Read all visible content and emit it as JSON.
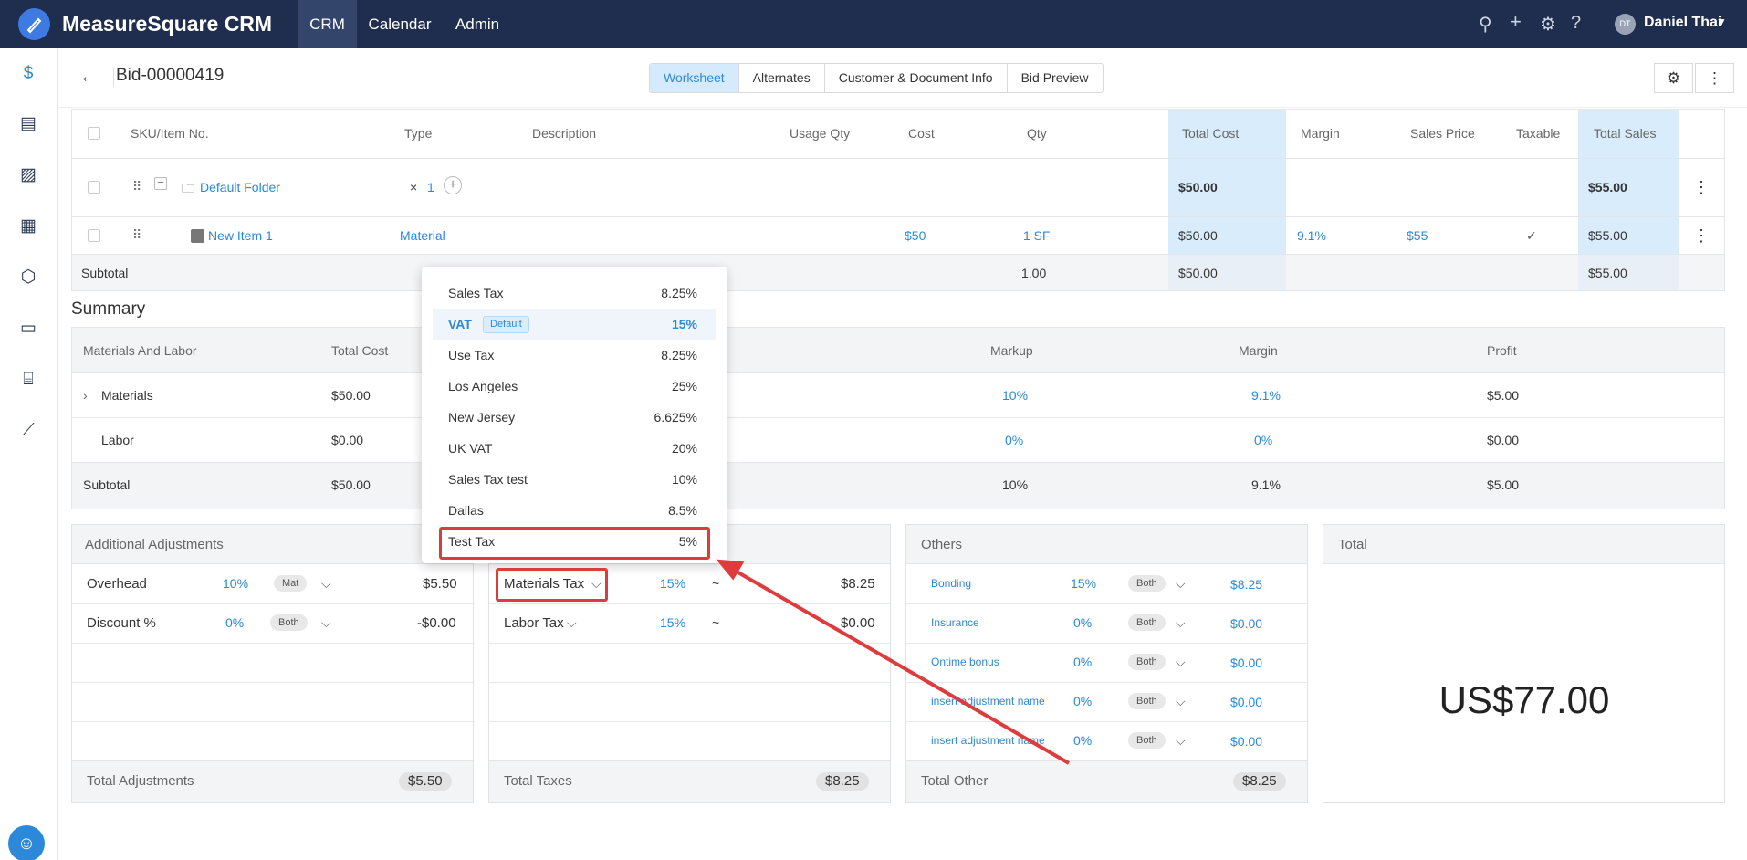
{
  "app": {
    "name": "MeasureSquare CRM",
    "nav": [
      "CRM",
      "Calendar",
      "Admin"
    ],
    "user_initials": "DT",
    "user_name": "Daniel Thai"
  },
  "header": {
    "title": "Bid-00000419",
    "tabs": [
      "Worksheet",
      "Alternates",
      "Customer & Document Info",
      "Bid Preview"
    ]
  },
  "grid": {
    "columns": [
      "SKU/Item No.",
      "Type",
      "Description",
      "Usage Qty",
      "Cost",
      "Qty",
      "Total Cost",
      "Margin",
      "Sales Price",
      "Taxable",
      "Total Sales"
    ],
    "folder": {
      "name": "Default Folder",
      "mult": "×",
      "qty": "1",
      "total_cost": "$50.00",
      "total_sales": "$55.00"
    },
    "item": {
      "name": "New Item 1",
      "type": "Material",
      "cost": "$50",
      "qty": "1 SF",
      "total_cost": "$50.00",
      "margin": "9.1%",
      "sales_price": "$55",
      "taxable": "✓",
      "total_sales": "$55.00"
    },
    "subtotal": {
      "label": "Subtotal",
      "qty": "1.00",
      "total_cost": "$50.00",
      "total_sales": "$55.00"
    }
  },
  "summary": {
    "title": "Summary",
    "columns": [
      "Materials And Labor",
      "Total Cost",
      "Markup",
      "Margin",
      "Profit"
    ],
    "rows": [
      {
        "name": "Materials",
        "cost": "$50.00",
        "markup": "10%",
        "margin": "9.1%",
        "profit": "$5.00"
      },
      {
        "name": "Labor",
        "cost": "$0.00",
        "markup": "0%",
        "margin": "0%",
        "profit": "$0.00"
      },
      {
        "name": "Subtotal",
        "cost": "$50.00",
        "markup": "10%",
        "margin": "9.1%",
        "profit": "$5.00"
      }
    ]
  },
  "adjustments": {
    "title": "Additional Adjustments",
    "rows": [
      {
        "name": "Overhead",
        "pct": "10%",
        "scope": "Mat",
        "amount": "$5.50"
      },
      {
        "name": "Discount %",
        "pct": "0%",
        "scope": "Both",
        "amount": "-$0.00"
      }
    ],
    "total_label": "Total Adjustments",
    "total": "$5.50"
  },
  "taxes": {
    "rows": [
      {
        "name": "Materials Tax",
        "pct": "15%",
        "sym": "~",
        "amount": "$8.25"
      },
      {
        "name": "Labor Tax",
        "pct": "15%",
        "sym": "~",
        "amount": "$0.00"
      }
    ],
    "total_label": "Total Taxes",
    "total": "$8.25"
  },
  "others": {
    "title": "Others",
    "rows": [
      {
        "name": "Bonding",
        "pct": "15%",
        "scope": "Both",
        "amount": "$8.25"
      },
      {
        "name": "Insurance",
        "pct": "0%",
        "scope": "Both",
        "amount": "$0.00"
      },
      {
        "name": "Ontime bonus",
        "pct": "0%",
        "scope": "Both",
        "amount": "$0.00"
      },
      {
        "name": "insert adjustment name",
        "pct": "0%",
        "scope": "Both",
        "amount": "$0.00"
      },
      {
        "name": "insert adjustment name",
        "pct": "0%",
        "scope": "Both",
        "amount": "$0.00"
      }
    ],
    "total_label": "Total Other",
    "total": "$8.25"
  },
  "total": {
    "title": "Total",
    "value": "US$77.00"
  },
  "tax_dropdown": {
    "options": [
      {
        "name": "Sales Tax",
        "value": "8.25%"
      },
      {
        "name": "VAT",
        "value": "15%",
        "badge": "Default"
      },
      {
        "name": "Use Tax",
        "value": "8.25%"
      },
      {
        "name": "Los Angeles",
        "value": "25%"
      },
      {
        "name": "New Jersey",
        "value": "6.625%"
      },
      {
        "name": "UK VAT",
        "value": "20%"
      },
      {
        "name": "Sales Tax test",
        "value": "10%"
      },
      {
        "name": "Dallas",
        "value": "8.5%"
      },
      {
        "name": "Test Tax",
        "value": "5%"
      }
    ]
  },
  "colors": {
    "topbar": "#1f2d4e",
    "accent": "#2c88d9",
    "highlight": "#de3c3c"
  }
}
